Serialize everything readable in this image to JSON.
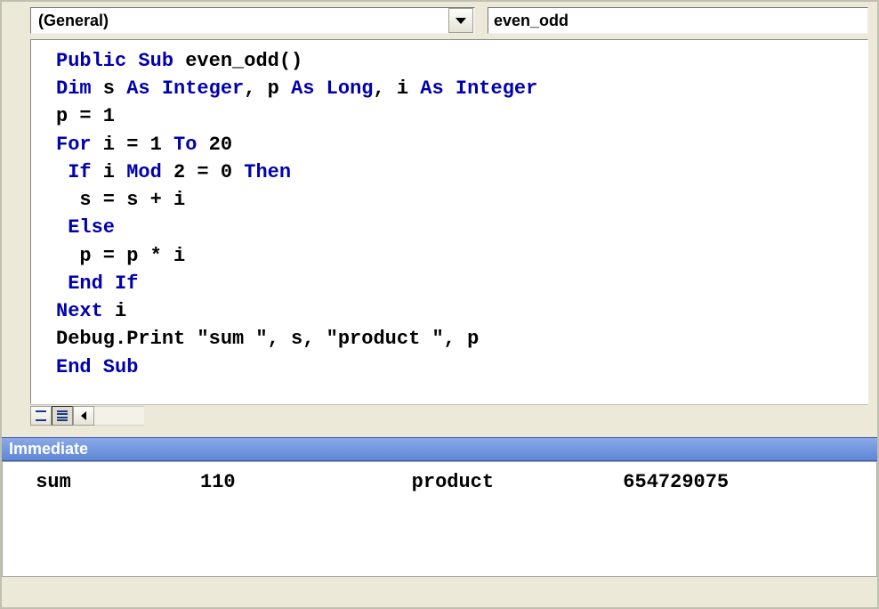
{
  "object_dropdown": {
    "value": "(General)"
  },
  "procedure_box": {
    "value": "even_odd"
  },
  "code": {
    "lines": [
      [
        {
          "t": "Public Sub",
          "c": "kw"
        },
        {
          "t": " even_odd()",
          "c": "txt"
        }
      ],
      [
        {
          "t": "Dim",
          "c": "kw"
        },
        {
          "t": " s ",
          "c": "txt"
        },
        {
          "t": "As Integer",
          "c": "kw"
        },
        {
          "t": ", p ",
          "c": "txt"
        },
        {
          "t": "As Long",
          "c": "kw"
        },
        {
          "t": ", i ",
          "c": "txt"
        },
        {
          "t": "As Integer",
          "c": "kw"
        }
      ],
      [
        {
          "t": "p = 1",
          "c": "txt"
        }
      ],
      [
        {
          "t": "For",
          "c": "kw"
        },
        {
          "t": " i = 1 ",
          "c": "txt"
        },
        {
          "t": "To",
          "c": "kw"
        },
        {
          "t": " 20",
          "c": "txt"
        }
      ],
      [
        {
          "t": " ",
          "c": "txt"
        },
        {
          "t": "If",
          "c": "kw"
        },
        {
          "t": " i ",
          "c": "txt"
        },
        {
          "t": "Mod",
          "c": "kw"
        },
        {
          "t": " 2 = 0 ",
          "c": "txt"
        },
        {
          "t": "Then",
          "c": "kw"
        }
      ],
      [
        {
          "t": "  s = s + i",
          "c": "txt"
        }
      ],
      [
        {
          "t": " ",
          "c": "txt"
        },
        {
          "t": "Else",
          "c": "kw"
        }
      ],
      [
        {
          "t": "  p = p * i",
          "c": "txt"
        }
      ],
      [
        {
          "t": " ",
          "c": "txt"
        },
        {
          "t": "End If",
          "c": "kw"
        }
      ],
      [
        {
          "t": "Next",
          "c": "kw"
        },
        {
          "t": " i",
          "c": "txt"
        }
      ],
      [
        {
          "t": "Debug.Print \"sum \", s, \"product \", p",
          "c": "txt"
        }
      ],
      [
        {
          "t": "End Sub",
          "c": "kw"
        }
      ]
    ]
  },
  "immediate": {
    "title": "Immediate",
    "columns": [
      " sum ",
      "110",
      "product ",
      "654729075"
    ]
  }
}
